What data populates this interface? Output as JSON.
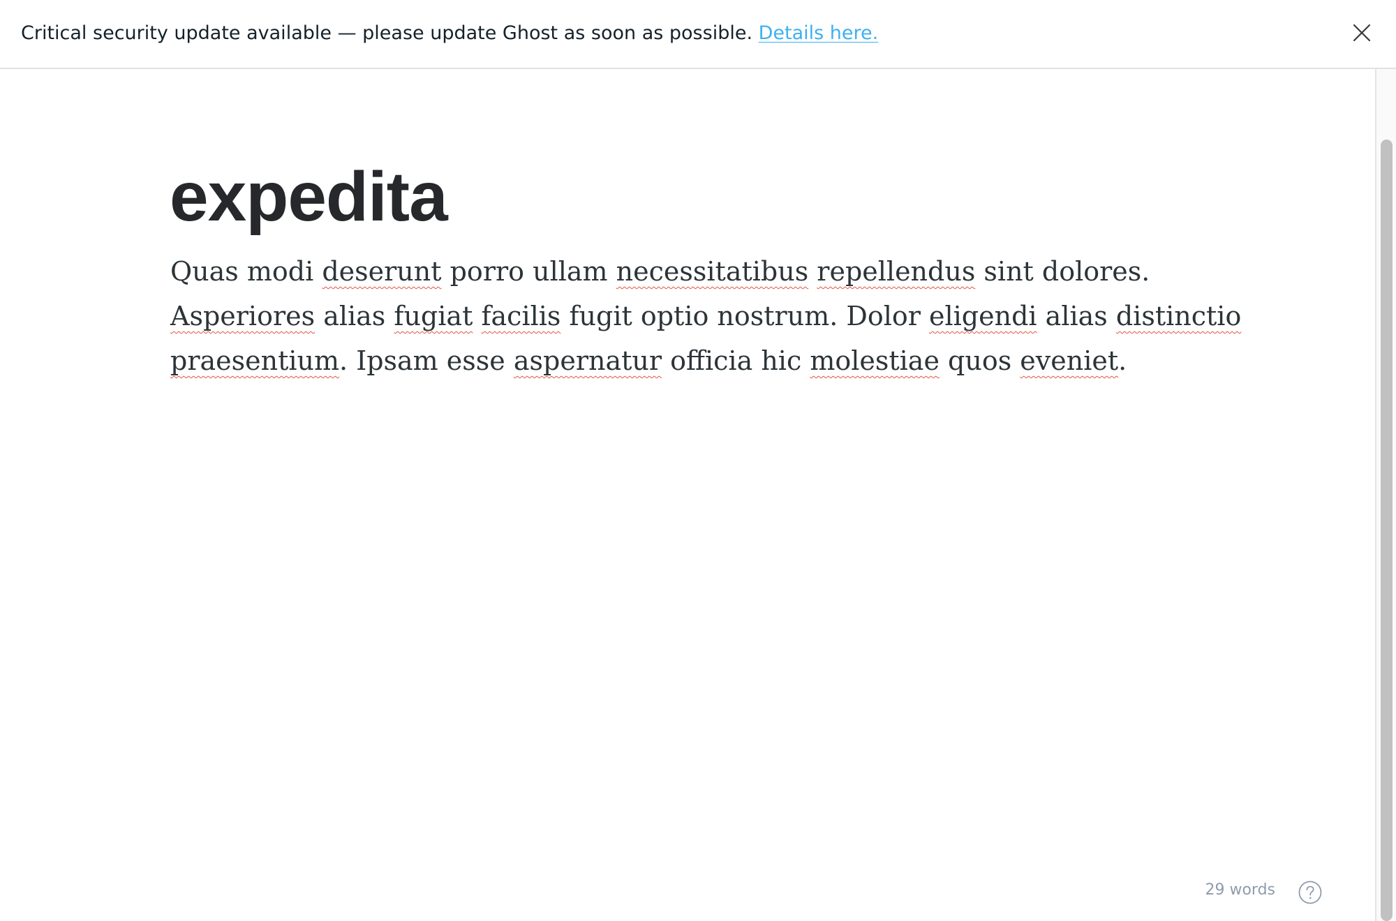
{
  "banner": {
    "message": "Critical security update available — please update Ghost as soon as possible.",
    "link_label": "Details here.",
    "close_icon": "close-icon",
    "link_color": "#3eb0ef"
  },
  "editor": {
    "title": "expedita",
    "body": {
      "paragraph": "Quas modi deserunt porro ullam necessitatibus repellendus sint dolores. Asperiores alias fugiat facilis fugit optio nostrum. Dolor eligendi alias distinctio praesentium. Ipsam esse aspernatur officia hic molestiae quos eveniet.",
      "lines": [
        [
          {
            "t": "Quas modi ",
            "s": false
          },
          {
            "t": "deserunt",
            "s": true
          },
          {
            "t": " porro ullam ",
            "s": false
          },
          {
            "t": "necessitatibus",
            "s": true
          },
          {
            "t": " ",
            "s": false
          },
          {
            "t": "repellendus",
            "s": true
          },
          {
            "t": " sint dolores.",
            "s": false
          }
        ],
        [
          {
            "t": "Asperiores",
            "s": true
          },
          {
            "t": " alias ",
            "s": false
          },
          {
            "t": "fugiat",
            "s": true
          },
          {
            "t": " ",
            "s": false
          },
          {
            "t": "facilis",
            "s": true
          },
          {
            "t": " fugit optio nostrum. Dolor ",
            "s": false
          },
          {
            "t": "eligendi",
            "s": true
          },
          {
            "t": " alias ",
            "s": false
          },
          {
            "t": "distinctio",
            "s": true
          }
        ],
        [
          {
            "t": "praesentium",
            "s": true
          },
          {
            "t": ". Ipsam esse ",
            "s": false
          },
          {
            "t": "aspernatur",
            "s": true
          },
          {
            "t": " officia hic ",
            "s": false
          },
          {
            "t": "molestiae",
            "s": true
          },
          {
            "t": " quos ",
            "s": false
          },
          {
            "t": "eveniet",
            "s": true
          },
          {
            "t": ".",
            "s": false
          }
        ]
      ],
      "spellcheck_color": "#e25440"
    }
  },
  "footer": {
    "word_count": "29 words",
    "help_icon": "help-icon"
  }
}
